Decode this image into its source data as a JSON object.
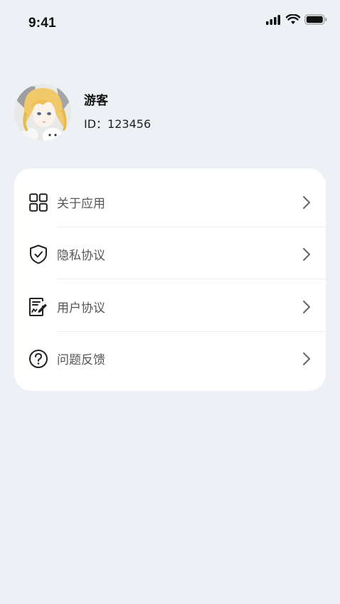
{
  "status_bar": {
    "time": "9:41"
  },
  "profile": {
    "name": "游客",
    "id_text": "ID：123456"
  },
  "menu": {
    "items": [
      {
        "label": "关于应用",
        "icon": "grid-icon"
      },
      {
        "label": "隐私协议",
        "icon": "shield-check-icon"
      },
      {
        "label": "用户协议",
        "icon": "document-sign-icon"
      },
      {
        "label": "问题反馈",
        "icon": "question-circle-icon"
      }
    ]
  },
  "colors": {
    "background": "#edf0f4",
    "card": "#ffffff",
    "label": "#555555",
    "chevron": "#666666"
  }
}
